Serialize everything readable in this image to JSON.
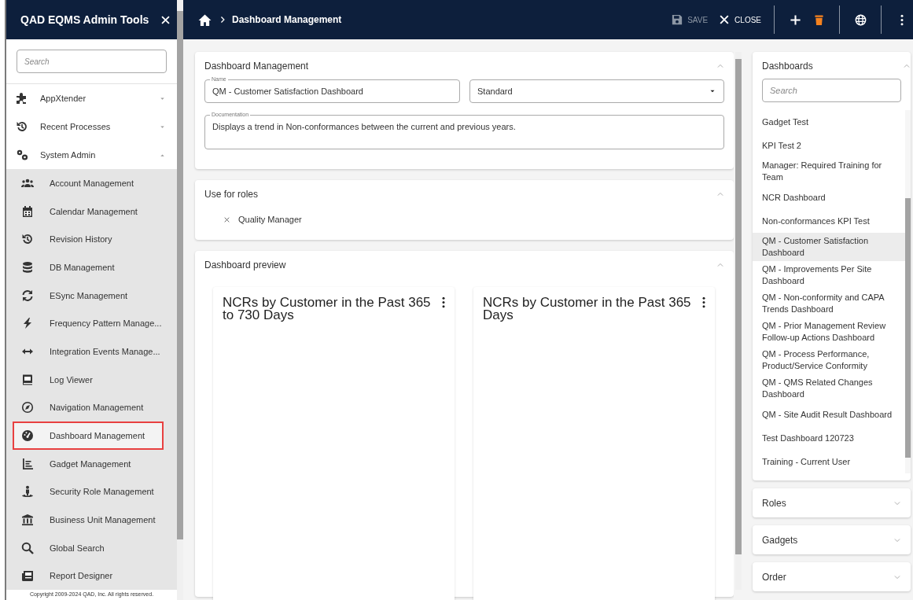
{
  "sidebar": {
    "title": "QAD EQMS Admin Tools",
    "search": {
      "placeholder": "Search"
    },
    "groups": [
      {
        "label": "AppXtender",
        "expanded": false
      },
      {
        "label": "Recent Processes",
        "expanded": false
      },
      {
        "label": "System Admin",
        "expanded": true,
        "children": [
          {
            "label": "Account Management",
            "selected": false
          },
          {
            "label": "Calendar Management",
            "selected": false
          },
          {
            "label": "Revision History",
            "selected": false
          },
          {
            "label": "DB Management",
            "selected": false
          },
          {
            "label": "ESync Management",
            "selected": false
          },
          {
            "label": "Frequency Pattern Manage...",
            "selected": false
          },
          {
            "label": "Integration Events Manage...",
            "selected": false
          },
          {
            "label": "Log Viewer",
            "selected": false
          },
          {
            "label": "Navigation Management",
            "selected": false
          },
          {
            "label": "Dashboard Management",
            "selected": true
          },
          {
            "label": "Gadget Management",
            "selected": false
          },
          {
            "label": "Security Role Management",
            "selected": false
          },
          {
            "label": "Business Unit Management",
            "selected": false
          },
          {
            "label": "Global Search",
            "selected": false
          },
          {
            "label": "Report Designer",
            "selected": false
          }
        ]
      }
    ],
    "copyright": "Copyright 2009-2024 QAD, Inc. All rights reserved."
  },
  "toolbar": {
    "breadcrumb": "Dashboard Management",
    "actions": [
      {
        "kind": "save",
        "label": "SAVE",
        "disabled": true
      },
      {
        "kind": "close",
        "label": "CLOSE",
        "disabled": false
      }
    ]
  },
  "editor": {
    "title": "Dashboard Management",
    "expanded": true,
    "name": {
      "label": "Name",
      "value": "QM - Customer Satisfaction Dashboard"
    },
    "type": {
      "value": "Standard"
    },
    "documentation": {
      "label": "Documentation",
      "value": "Displays a trend in Non-conformances between the current and previous years."
    }
  },
  "roles_section": {
    "title": "Use for roles",
    "expanded": true,
    "roles": [
      "Quality Manager"
    ]
  },
  "preview": {
    "title": "Dashboard preview",
    "expanded": true,
    "gadgets": [
      {
        "title": "NCRs by Customer in the Past 365 to 730 Days"
      },
      {
        "title": "NCRs by Customer in the Past 365 Days"
      }
    ]
  },
  "dashboards": {
    "title": "Dashboards",
    "expanded": true,
    "search": {
      "placeholder": "Search"
    },
    "items": [
      {
        "label": "Gadget Test",
        "selected": false
      },
      {
        "label": "KPI Test 2",
        "selected": false
      },
      {
        "label": "Manager: Required Training for Team",
        "selected": false
      },
      {
        "label": "NCR Dashboard",
        "selected": false
      },
      {
        "label": "Non-conformances KPI Test",
        "selected": false
      },
      {
        "label": "QM - Customer Satisfaction Dashboard",
        "selected": true
      },
      {
        "label": "QM - Improvements Per Site Dashboard",
        "selected": false
      },
      {
        "label": "QM - Non-conformity and CAPA Trends Dashboard",
        "selected": false
      },
      {
        "label": "QM - Prior Management Review Follow-up Actions Dashboard",
        "selected": false
      },
      {
        "label": "QM - Process Performance, Product/Service Conformity",
        "selected": false
      },
      {
        "label": "QM - QMS Related Changes Dashboard",
        "selected": false
      },
      {
        "label": "QM - Site Audit Result Dashboard",
        "selected": false
      },
      {
        "label": "Test Dashboard 120723",
        "selected": false
      },
      {
        "label": "Training - Current User",
        "selected": false
      }
    ]
  },
  "collapsed_panels": [
    {
      "title": "Roles",
      "expanded": false
    },
    {
      "title": "Gadgets",
      "expanded": false
    },
    {
      "title": "Order",
      "expanded": false
    }
  ]
}
